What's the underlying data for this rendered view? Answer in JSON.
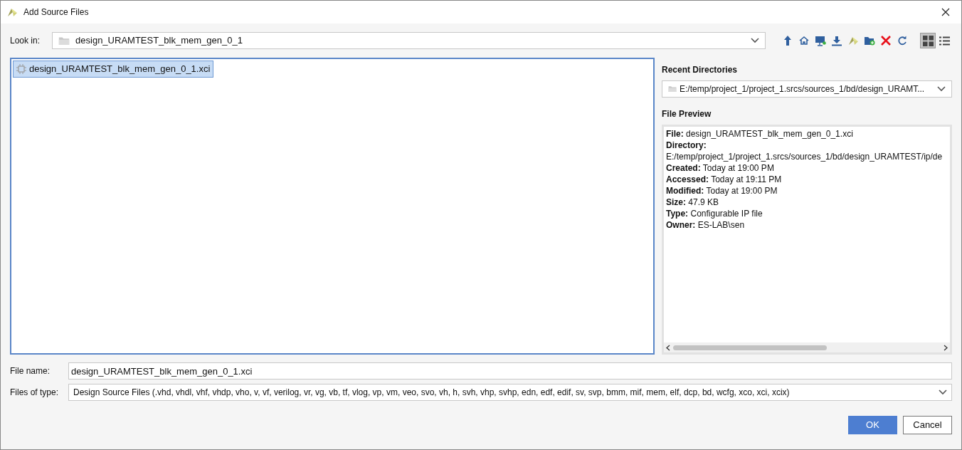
{
  "window": {
    "title": "Add Source Files"
  },
  "look_in": {
    "label": "Look in:",
    "value": "design_URAMTEST_blk_mem_gen_0_1"
  },
  "toolbar": {
    "views": [
      {
        "kind": "grid",
        "selected": true
      },
      {
        "kind": "list",
        "selected": false
      }
    ]
  },
  "files": [
    {
      "name": "design_URAMTEST_blk_mem_gen_0_1.xci",
      "selected": true
    }
  ],
  "recent_directories": {
    "title": "Recent Directories",
    "value": "E:/temp/project_1/project_1.srcs/sources_1/bd/design_URAMT..."
  },
  "file_preview": {
    "title": "File Preview",
    "lines": [
      {
        "label": "File:",
        "value": "design_URAMTEST_blk_mem_gen_0_1.xci"
      },
      {
        "label": "Directory:"
      },
      {
        "value": "E:/temp/project_1/project_1.srcs/sources_1/bd/design_URAMTEST/ip/de"
      },
      {
        "label": "Created:",
        "value": "Today at 19:00 PM"
      },
      {
        "label": "Accessed:",
        "value": "Today at 19:11 PM"
      },
      {
        "label": "Modified:",
        "value": "Today at 19:00 PM"
      },
      {
        "label": "Size:",
        "value": "47.9 KB"
      },
      {
        "label": "Type:",
        "value": "Configurable IP file"
      },
      {
        "label": "Owner:",
        "value": "ES-LAB\\sen"
      }
    ]
  },
  "file_name": {
    "label": "File name:",
    "value": "design_URAMTEST_blk_mem_gen_0_1.xci"
  },
  "files_of_type": {
    "label": "Files of type:",
    "value": "Design Source Files (.vhd, vhdl, vhf, vhdp, vho, v, vf, verilog, vr, vg, vb, tf, vlog, vp, vm, veo, svo, vh, h, svh, vhp, svhp, edn, edf, edif, sv, svp, bmm, mif, mem, elf, dcp, bd, wcfg, xco, xci, xcix)"
  },
  "buttons": [
    "OK",
    "Cancel"
  ]
}
